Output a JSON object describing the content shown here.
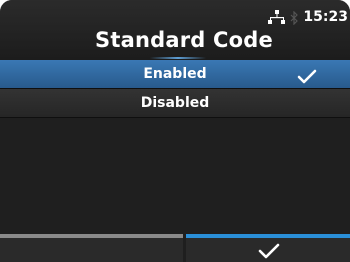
{
  "header": {
    "title": "Standard Code",
    "clock": "15:23",
    "status_icons": [
      "network-icon",
      "bluetooth-icon"
    ]
  },
  "options": [
    {
      "label": "Enabled",
      "selected": true
    },
    {
      "label": "Disabled",
      "selected": false
    }
  ],
  "footer": {
    "left_button_icon": "blank",
    "right_button_icon": "check-icon"
  },
  "colors": {
    "selected_row": "#3a78b4",
    "accent": "#2a8fd8",
    "background": "#1f1f1f"
  }
}
